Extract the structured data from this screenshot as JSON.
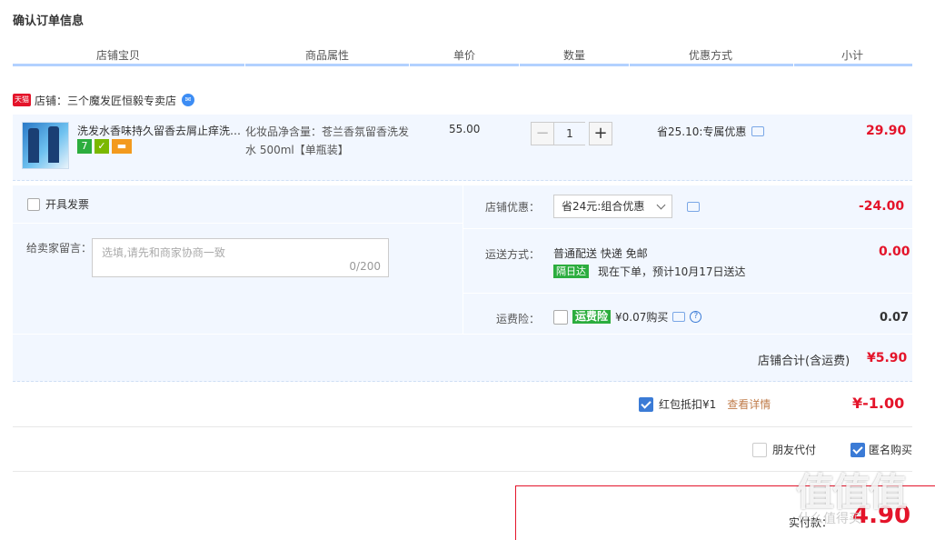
{
  "page_title": "确认订单信息",
  "columns": [
    "店铺宝贝",
    "商品属性",
    "单价",
    "数量",
    "优惠方式",
    "小计"
  ],
  "shop": {
    "badge": "天猫",
    "label": "店铺：三个魔发匠恒毅专卖店"
  },
  "item": {
    "name": "洗发水香味持久留香去屑止痒洗…",
    "attr_line1": "化妆品净含量：苍兰香氛留香洗发",
    "attr_line2": "水 500ml【单瓶装】",
    "price": "55.00",
    "quantity": "1",
    "promo": "省25.10:专属优惠",
    "subtotal": "29.90",
    "icon7": "7"
  },
  "invoice": {
    "label": "开具发票",
    "checked": false
  },
  "message": {
    "label": "给卖家留言：",
    "placeholder": "选填,请先和商家协商一致",
    "count": "0/200"
  },
  "shop_discount": {
    "label": "店铺优惠：",
    "selected": "省24元:组合优惠",
    "amount": "-24.00"
  },
  "shipping": {
    "label": "运送方式：",
    "method": "普通配送 快递 免邮",
    "badge": "隔日达",
    "eta": "现在下单，预计10月17日送达",
    "amount": "0.00"
  },
  "insurance": {
    "label": "运费险：",
    "badge": "运费险",
    "price": "¥0.07购买",
    "amount": "0.07",
    "help": "?"
  },
  "shop_total": {
    "label": "店铺合计(含运费)",
    "amount": "¥5.90"
  },
  "redpacket": {
    "label": "红包抵扣¥1",
    "link": "查看详情",
    "amount": "¥-1.00",
    "checked": true
  },
  "friend_pay": {
    "label": "朋友代付",
    "checked": false
  },
  "anonymous": {
    "label": "匿名购买",
    "checked": true
  },
  "actual_pay": {
    "label": "实付款：",
    "amount": "4.90"
  },
  "watermark": {
    "text": "值值值",
    "sub": "什么值得买"
  },
  "colors": {
    "accent_red": "#e4142a",
    "table_header_line": "#b2d1ff",
    "row_bg": "#f2f7ff",
    "check_blue": "#3b7bd6"
  }
}
